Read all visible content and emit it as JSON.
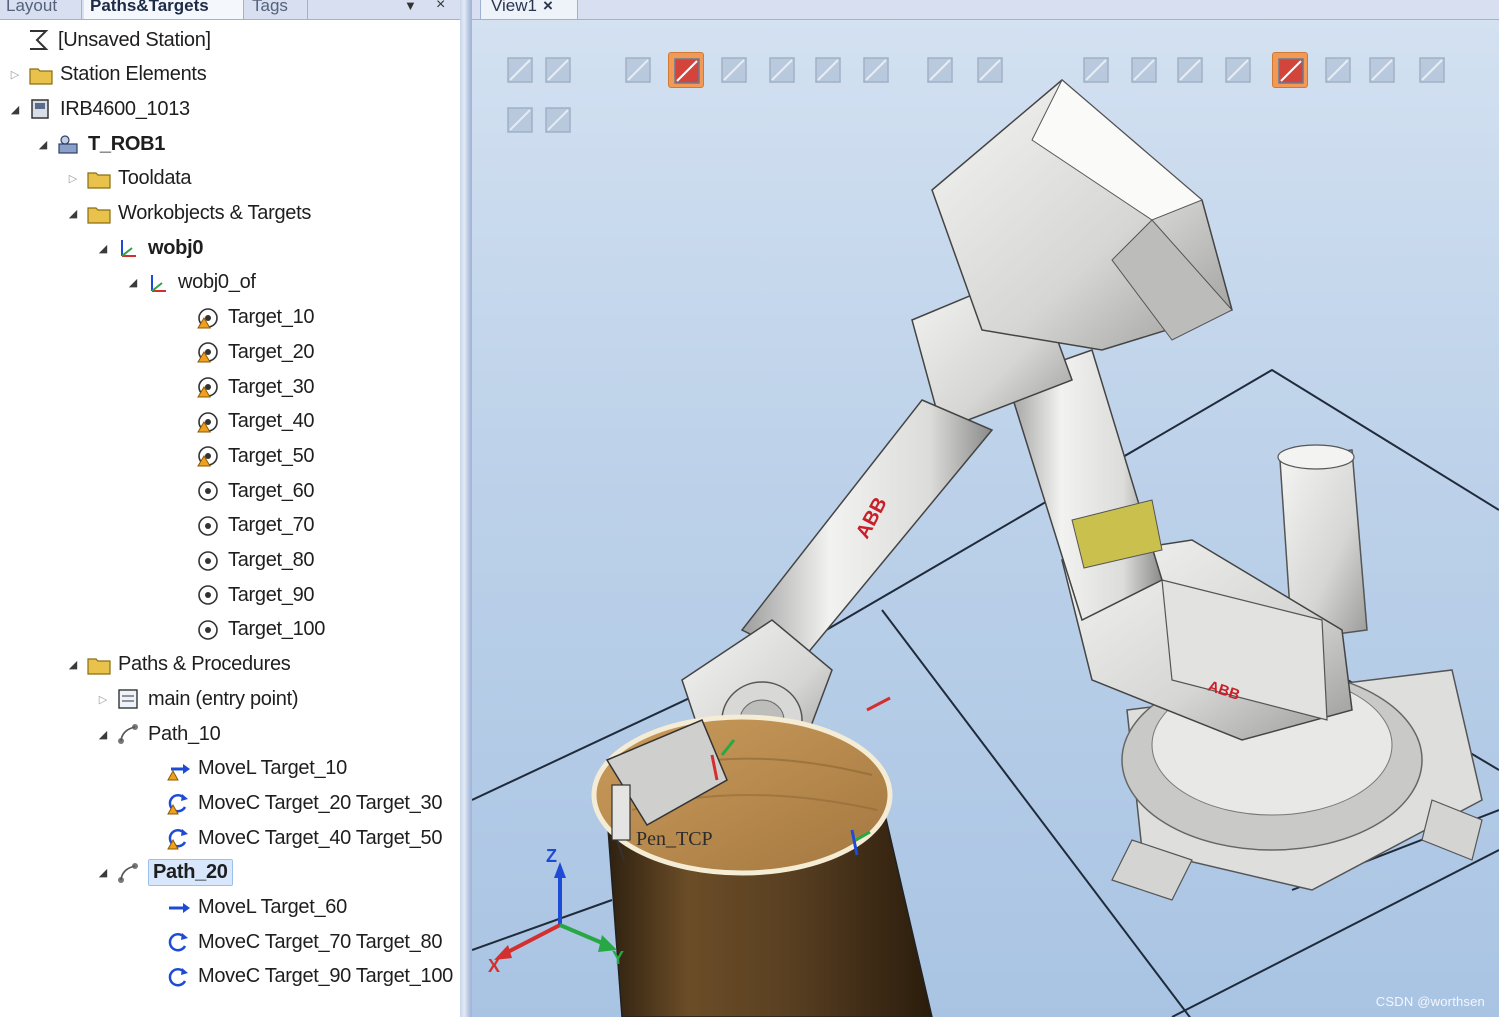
{
  "left_panel": {
    "tabs": [
      {
        "label": "Layout",
        "active": false
      },
      {
        "label": "Paths&Targets",
        "active": true
      },
      {
        "label": "Tags",
        "active": false
      }
    ],
    "menu_glyph": "▼",
    "close_glyph": "×"
  },
  "tree": [
    {
      "label": "[Unsaved Station]",
      "icon": "station-icon",
      "arrow": "",
      "bold": false
    },
    {
      "label": "Station Elements",
      "icon": "folder-icon",
      "arrow": "collapsed",
      "bold": false
    },
    {
      "label": "IRB4600_1013",
      "icon": "controller-icon",
      "arrow": "expanded",
      "bold": false
    },
    {
      "label": "T_ROB1",
      "icon": "task-icon",
      "arrow": "expanded",
      "bold": true
    },
    {
      "label": "Tooldata",
      "icon": "tooldata-folder-icon",
      "arrow": "collapsed",
      "bold": false
    },
    {
      "label": "Workobjects & Targets",
      "icon": "workobjects-folder-icon",
      "arrow": "expanded",
      "bold": false
    },
    {
      "label": "wobj0",
      "icon": "workobject-icon",
      "arrow": "expanded",
      "bold": true
    },
    {
      "label": "wobj0_of",
      "icon": "workobject-frame-icon",
      "arrow": "expanded",
      "bold": false
    },
    {
      "label": "Target_10",
      "icon": "target-warning-icon",
      "arrow": "",
      "bold": false
    },
    {
      "label": "Target_20",
      "icon": "target-warning-icon",
      "arrow": "",
      "bold": false
    },
    {
      "label": "Target_30",
      "icon": "target-warning-icon",
      "arrow": "",
      "bold": false
    },
    {
      "label": "Target_40",
      "icon": "target-warning-icon",
      "arrow": "",
      "bold": false
    },
    {
      "label": "Target_50",
      "icon": "target-warning-icon",
      "arrow": "",
      "bold": false
    },
    {
      "label": "Target_60",
      "icon": "target-icon",
      "arrow": "",
      "bold": false
    },
    {
      "label": "Target_70",
      "icon": "target-icon",
      "arrow": "",
      "bold": false
    },
    {
      "label": "Target_80",
      "icon": "target-icon",
      "arrow": "",
      "bold": false
    },
    {
      "label": "Target_90",
      "icon": "target-icon",
      "arrow": "",
      "bold": false
    },
    {
      "label": "Target_100",
      "icon": "target-icon",
      "arrow": "",
      "bold": false
    },
    {
      "label": "Paths & Procedures",
      "icon": "paths-folder-icon",
      "arrow": "expanded",
      "bold": false
    },
    {
      "label": "main (entry point)",
      "icon": "procedure-icon",
      "arrow": "collapsed",
      "bold": false
    },
    {
      "label": "Path_10",
      "icon": "path-icon",
      "arrow": "expanded",
      "bold": false
    },
    {
      "label": "MoveL Target_10",
      "icon": "movel-warning-icon",
      "arrow": "",
      "bold": false
    },
    {
      "label": "MoveC Target_20 Target_30",
      "icon": "movec-warning-icon",
      "arrow": "",
      "bold": false
    },
    {
      "label": "MoveC Target_40 Target_50",
      "icon": "movec-warning-icon",
      "arrow": "",
      "bold": false
    },
    {
      "label": "Path_20",
      "icon": "path-icon",
      "arrow": "expanded",
      "bold": true,
      "selected": true
    },
    {
      "label": "MoveL Target_60",
      "icon": "movel-icon",
      "arrow": "",
      "bold": false
    },
    {
      "label": "MoveC Target_70 Target_80",
      "icon": "movec-icon",
      "arrow": "",
      "bold": false
    },
    {
      "label": "MoveC Target_90 Target_100",
      "icon": "movec-icon",
      "arrow": "",
      "bold": false
    }
  ],
  "view": {
    "tab_label": "View1",
    "tab_close": "×",
    "tcp_label": "Pen_TCP",
    "axis_labels": {
      "z": "Z",
      "x": "X",
      "y": "Y"
    },
    "watermark": "CSDN @worthsen",
    "toolbar_icons": [
      {
        "name": "view-all-icon",
        "active": false
      },
      {
        "name": "view-grid-icon",
        "active": false
      },
      {
        "name": "select-curve-icon",
        "active": false
      },
      {
        "name": "select-surface-icon",
        "active": true
      },
      {
        "name": "select-body-icon",
        "active": false
      },
      {
        "name": "select-part-icon",
        "active": false
      },
      {
        "name": "select-group-icon",
        "active": false
      },
      {
        "name": "select-mechanism-icon",
        "active": false
      },
      {
        "name": "select-target-icon",
        "active": false
      },
      {
        "name": "snap-object-icon",
        "active": false
      },
      {
        "name": "snap-center-icon",
        "active": false
      },
      {
        "name": "snap-edge-icon",
        "active": false
      },
      {
        "name": "snap-midpoint-icon",
        "active": false
      },
      {
        "name": "snap-end-icon",
        "active": false
      },
      {
        "name": "snap-local-origin-icon",
        "active": true
      },
      {
        "name": "snap-grid-icon",
        "active": false
      },
      {
        "name": "measure-angle-icon",
        "active": false
      },
      {
        "name": "measure-distance-icon",
        "active": false
      },
      {
        "name": "play-icon",
        "active": false
      },
      {
        "name": "stop-icon",
        "active": false
      }
    ],
    "colors": {
      "robot_body": "#e6e6e4",
      "abb_red": "#c8202a",
      "cylinder_wood": "#5a4022",
      "floor_line": "#1f2b3b",
      "active_tool": "#f29a55"
    }
  }
}
